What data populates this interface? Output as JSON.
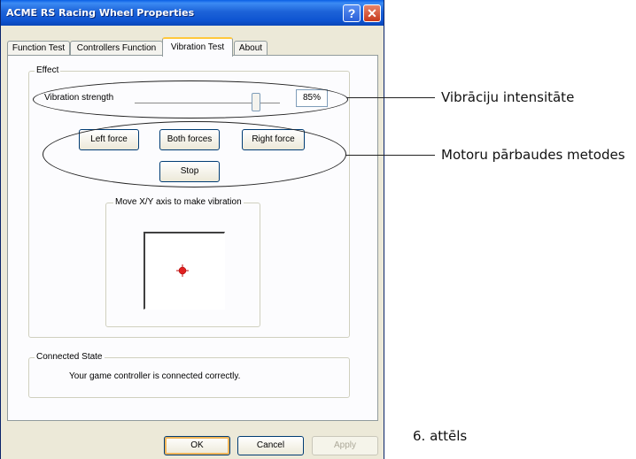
{
  "window": {
    "title": "ACME RS Racing Wheel Properties",
    "help_glyph": "?",
    "close_glyph": "✕"
  },
  "tabs": [
    {
      "label": "Function Test",
      "active": false
    },
    {
      "label": "Controllers Function",
      "active": false
    },
    {
      "label": "Vibration Test",
      "active": true
    },
    {
      "label": "About",
      "active": false
    }
  ],
  "effect": {
    "group_label": "Effect",
    "vibration_label": "Vibration strength",
    "vibration_value_text": "85%",
    "vibration_value": 0.85,
    "left_force": "Left force",
    "both_forces": "Both forces",
    "right_force": "Right force",
    "stop": "Stop"
  },
  "axis": {
    "group_label": "Move X/Y axis to make vibration",
    "marker_color": "#e02020"
  },
  "connection": {
    "group_label": "Connected State",
    "status_text": "Your game controller is connected correctly."
  },
  "footer": {
    "ok": "OK",
    "cancel": "Cancel",
    "apply": "Apply"
  },
  "annotations": {
    "vibration_intensity": "Vibrāciju intensitāte",
    "motor_test_methods": "Motoru pārbaudes metodes",
    "figure_caption": "6. attēls"
  }
}
